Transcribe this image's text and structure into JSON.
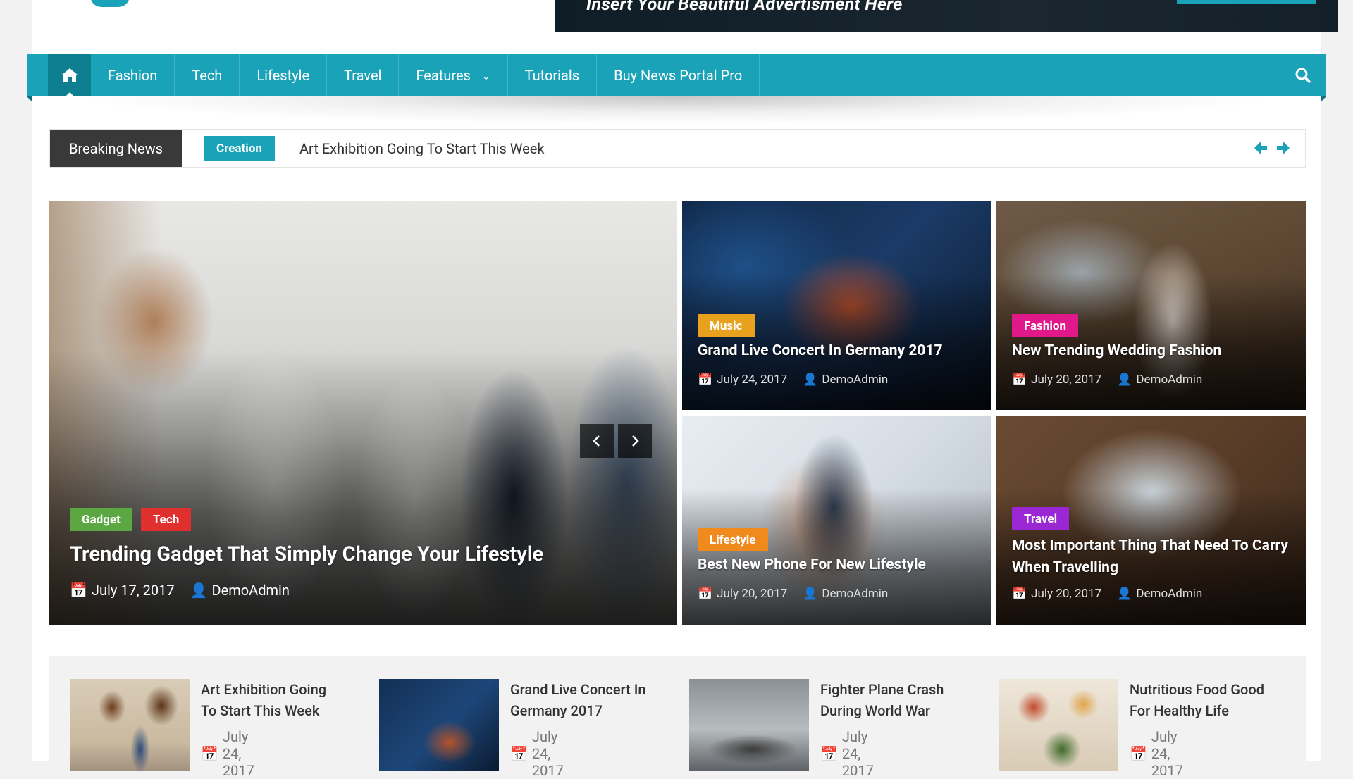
{
  "ad": {
    "text": "Insert Your Beautiful Advertisment Here"
  },
  "nav": {
    "items": [
      {
        "label": "Fashion",
        "dropdown": false
      },
      {
        "label": "Tech",
        "dropdown": false
      },
      {
        "label": "Lifestyle",
        "dropdown": false
      },
      {
        "label": "Travel",
        "dropdown": false
      },
      {
        "label": "Features",
        "dropdown": true
      },
      {
        "label": "Tutorials",
        "dropdown": false
      },
      {
        "label": "Buy News Portal Pro",
        "dropdown": false
      }
    ]
  },
  "breaking": {
    "label": "Breaking News",
    "tag": "Creation",
    "headline": "Art Exhibition Going To Start This Week"
  },
  "featured": {
    "main": {
      "tags": [
        {
          "label": "Gadget",
          "color": "#5ba843"
        },
        {
          "label": "Tech",
          "color": "#e0302e"
        }
      ],
      "title": "Trending Gadget That Simply Change Your Lifestyle",
      "date": "July 17, 2017",
      "author": "DemoAdmin"
    },
    "cards": [
      {
        "tag": "Music",
        "tag_color": "#e8a11c",
        "title": "Grand Live Concert In Germany 2017",
        "date": "July 24, 2017",
        "author": "DemoAdmin"
      },
      {
        "tag": "Fashion",
        "tag_color": "#e0188a",
        "title": "New Trending Wedding Fashion",
        "date": "July 20, 2017",
        "author": "DemoAdmin"
      },
      {
        "tag": "Lifestyle",
        "tag_color": "#f08a1c",
        "title": "Best New Phone For New Lifestyle",
        "date": "July 20, 2017",
        "author": "DemoAdmin"
      },
      {
        "tag": "Travel",
        "tag_color": "#9b27d4",
        "title": "Most Important Thing That Need To Carry When Travelling",
        "date": "July 20, 2017",
        "author": "DemoAdmin"
      }
    ]
  },
  "latest": [
    {
      "title": "Art Exhibition Going To Start This Week",
      "date": "July 24, 2017"
    },
    {
      "title": "Grand Live Concert In Germany 2017",
      "date": "July 24, 2017"
    },
    {
      "title": "Fighter Plane Crash During World War",
      "date": "July 24, 2017"
    },
    {
      "title": "Nutritious Food Good For Healthy Life",
      "date": "July 24, 2017"
    }
  ],
  "colors": {
    "accent": "#1aa3b8",
    "dark": "#393939"
  },
  "icons": {
    "home": "home-icon",
    "search": "search-icon",
    "calendar": "calendar-icon",
    "user": "user-icon",
    "arrow_left": "arrow-left-icon",
    "arrow_right": "arrow-right-icon",
    "chevron_left": "chevron-left-icon",
    "chevron_right": "chevron-right-icon",
    "chevron_down": "chevron-down-icon"
  }
}
